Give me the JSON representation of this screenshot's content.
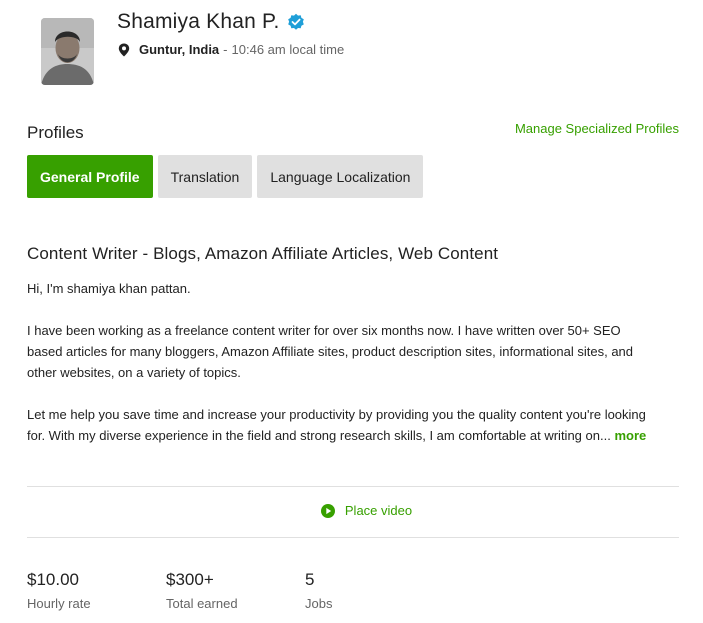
{
  "profile": {
    "name": "Shamiya Khan P.",
    "verified_icon": "verified-check-icon",
    "location_icon": "map-pin-icon",
    "city": "Guntur, India",
    "separator": "-",
    "local_time": "10:46 am local time"
  },
  "profiles_section": {
    "title": "Profiles",
    "manage_link": "Manage Specialized Profiles",
    "tabs": [
      {
        "label": "General Profile",
        "active": true
      },
      {
        "label": "Translation",
        "active": false
      },
      {
        "label": "Language Localization",
        "active": false
      }
    ]
  },
  "overview": {
    "title": "Content Writer - Blogs, Amazon Affiliate Articles, Web Content",
    "paragraphs": [
      "Hi, I'm shamiya khan pattan.",
      "I have been working as a freelance content writer for over six months now. I have written over 50+ SEO based articles for many bloggers, Amazon Affiliate sites, product description sites, informational sites, and other websites, on a variety of topics.",
      "Let me help you save time and increase your productivity by providing you the quality content you're looking for. With my diverse experience in the field and strong research skills, I am comfortable at writing on..."
    ],
    "more_link": "more"
  },
  "video": {
    "label": "Place video",
    "icon": "play-circle-icon"
  },
  "stats": [
    {
      "value": "$10.00",
      "label": "Hourly rate"
    },
    {
      "value": "$300+",
      "label": "Total earned"
    },
    {
      "value": "5",
      "label": "Jobs"
    }
  ],
  "colors": {
    "accent": "#37a000",
    "verified": "#1f9fd8",
    "tab_inactive": "#e0e0e0",
    "muted_text": "#656565"
  }
}
